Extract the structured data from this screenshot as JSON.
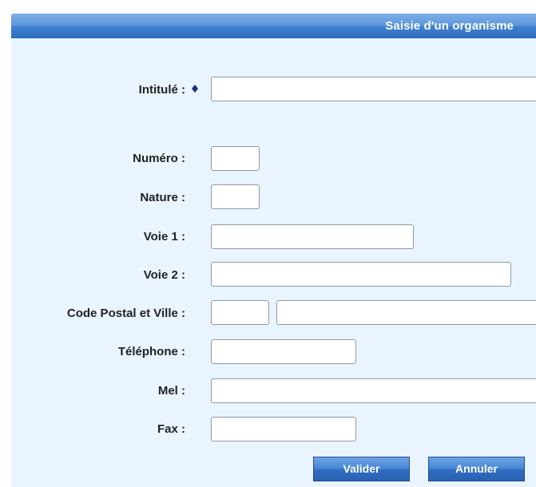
{
  "header": {
    "title": "Saisie d'un organisme"
  },
  "form": {
    "intitule": {
      "label": "Intitulé :",
      "value": ""
    },
    "numero": {
      "label": "Numéro :",
      "value": ""
    },
    "nature": {
      "label": "Nature :",
      "value": ""
    },
    "voie1": {
      "label": "Voie 1 :",
      "value": ""
    },
    "voie2": {
      "label": "Voie 2 :",
      "value": ""
    },
    "code_postal_ville": {
      "label": "Code Postal et Ville :",
      "code_postal_value": "",
      "ville_value": ""
    },
    "telephone": {
      "label": "Téléphone :",
      "value": ""
    },
    "mel": {
      "label": "Mel :",
      "value": ""
    },
    "fax": {
      "label": "Fax :",
      "value": ""
    }
  },
  "buttons": {
    "valider": "Valider",
    "annuler": "Annuler"
  },
  "colors": {
    "header_bg": "#3e7fd0",
    "panel_bg": "#eaf4fe",
    "required_marker": "#1a2a8a"
  }
}
